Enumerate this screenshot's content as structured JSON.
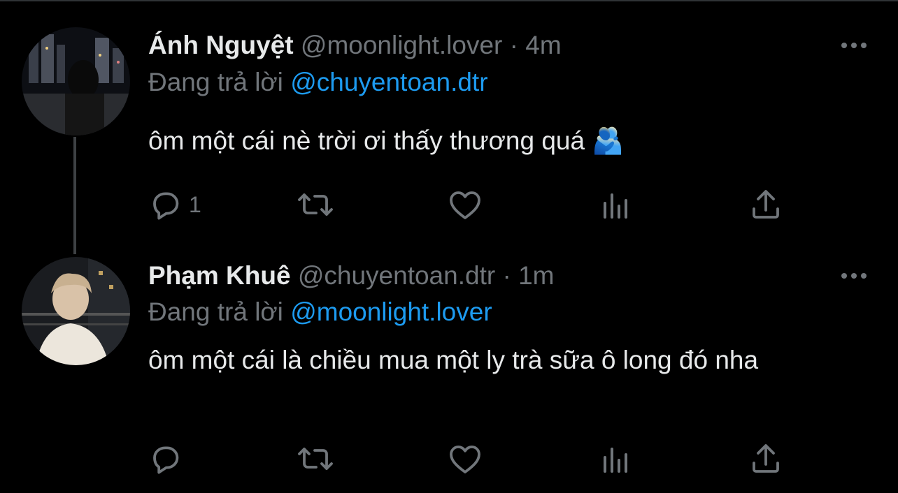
{
  "tweets": [
    {
      "display_name": "Ánh Nguyệt",
      "handle": "@moonlight.lover",
      "separator": "·",
      "time": "4m",
      "reply_prefix": "Đang trả lời",
      "reply_to": "@chuyentoan.dtr",
      "text": "ôm một cái nè trời ơi thấy thương quá 🫂",
      "reply_count": "1",
      "avatar_icon": "avatar-city-night-woman"
    },
    {
      "display_name": "Phạm Khuê",
      "handle": "@chuyentoan.dtr",
      "separator": "·",
      "time": "1m",
      "reply_prefix": "Đang trả lời",
      "reply_to": "@moonlight.lover",
      "text": "ôm một cái là chiều mua một ly trà sữa ô long đó nha",
      "reply_count": "",
      "avatar_icon": "avatar-man-night"
    }
  ],
  "action_icons": [
    "reply-icon",
    "retweet-icon",
    "like-icon",
    "analytics-icon",
    "share-icon"
  ],
  "colors": {
    "background": "#000000",
    "primary_text": "#E7E9EA",
    "secondary_text": "#71767B",
    "mention": "#1D9BF0",
    "thread_line": "#3E4144"
  }
}
